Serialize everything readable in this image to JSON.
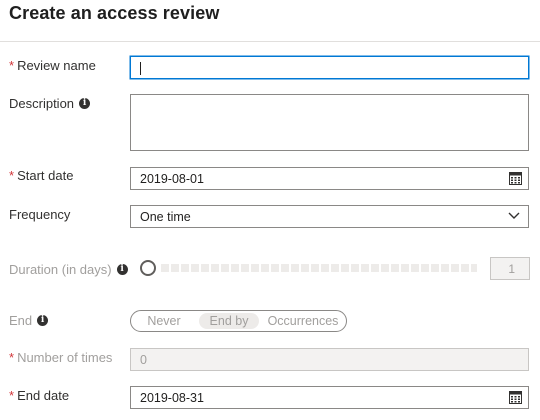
{
  "page": {
    "title": "Create an access review"
  },
  "form": {
    "review_name": {
      "label": "Review name",
      "required": true,
      "value": ""
    },
    "description": {
      "label": "Description",
      "value": ""
    },
    "start_date": {
      "label": "Start date",
      "required": true,
      "value": "2019-08-01"
    },
    "frequency": {
      "label": "Frequency",
      "value": "One time"
    },
    "duration": {
      "label": "Duration (in days)",
      "value": "1",
      "disabled": true
    },
    "end": {
      "label": "End",
      "options": [
        "Never",
        "End by",
        "Occurrences"
      ],
      "selected": "End by",
      "disabled": true
    },
    "number_of_times": {
      "label": "Number of times",
      "required": true,
      "value": "0",
      "disabled": true
    },
    "end_date": {
      "label": "End date",
      "required": true,
      "value": "2019-08-31"
    }
  },
  "required_marker": "*",
  "info_glyph": "i",
  "icons": {
    "info": "info-icon",
    "calendar": "calendar-icon",
    "chevron": "chevron-down-icon"
  },
  "colors": {
    "accent": "#0078d4",
    "required": "#d13438",
    "disabled_text": "#a19f9d",
    "border": "#8a8886"
  }
}
